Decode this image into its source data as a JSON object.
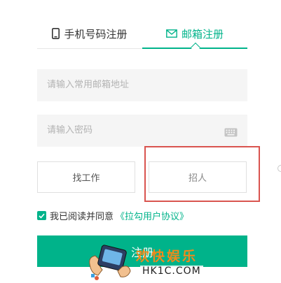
{
  "tabs": {
    "phone_label": "手机号码注册",
    "email_label": "邮箱注册",
    "active": "email"
  },
  "form": {
    "email_placeholder": "请输入常用邮箱地址",
    "password_placeholder": "请输入密码"
  },
  "roles": {
    "job_seeker_label": "找工作",
    "recruiter_label": "招人"
  },
  "agreement": {
    "checked": true,
    "text": "我已阅读并同意",
    "link_text": "《拉勾用户协议》"
  },
  "submit": {
    "label": "注册"
  },
  "watermark": {
    "chinese": "欢快娱乐",
    "latin": "HK1C.COM"
  },
  "colors": {
    "accent": "#00b38a",
    "highlight": "#d9544f",
    "field_bg": "#f5f5f5"
  }
}
